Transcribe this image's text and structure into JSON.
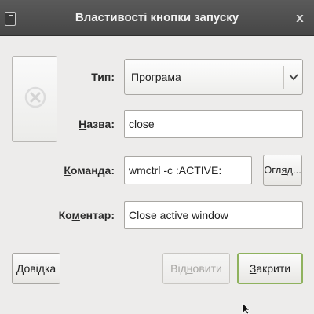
{
  "window": {
    "title": "Властивості кнопки запуску",
    "close_glyph": "x",
    "menu_icon": "window-menu-icon"
  },
  "launcher_icon": {
    "icon": "close-x-icon",
    "color": "#d0d0d0"
  },
  "form": {
    "type": {
      "label_u": "Т",
      "label_rest": "ип:",
      "value": "Програма",
      "arrow": "v"
    },
    "name": {
      "label_u": "Н",
      "label_rest": "азва:",
      "value": "close"
    },
    "command": {
      "label_u": "К",
      "label_rest": "оманда:",
      "value": "wmctrl -c :ACTIVE:",
      "browse_pre": "Огл",
      "browse_u": "я",
      "browse_post": "д..."
    },
    "comment": {
      "label_pre": "Ко",
      "label_u": "м",
      "label_rest": "ентар:",
      "value": "Close active window"
    }
  },
  "buttons": {
    "help": {
      "u": "Д",
      "rest": "овідка"
    },
    "revert": {
      "pre": "Від",
      "u": "н",
      "rest": "овити",
      "disabled": true
    },
    "close": {
      "u": "З",
      "rest": "акрити",
      "accent": "#8fb25e"
    }
  }
}
